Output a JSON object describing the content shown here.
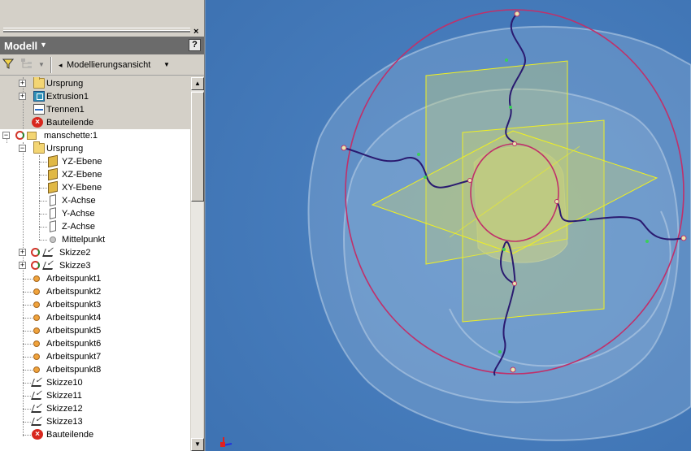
{
  "panel": {
    "close_glyph": "×",
    "title": "Modell",
    "title_arrow": "▼",
    "help_label": "?"
  },
  "toolbar": {
    "filter_icon": "filter-icon",
    "hierarchy_icon": "hierarchy-icon",
    "view_label": "Modellierungsansicht",
    "dropdown_glyph": "▼"
  },
  "tree": {
    "items": [
      {
        "label": "Ursprung",
        "icon": "folder"
      },
      {
        "label": "Extrusion1",
        "icon": "extrude"
      },
      {
        "label": "Trennen1",
        "icon": "split"
      },
      {
        "label": "Bauteilende",
        "icon": "stop"
      },
      {
        "label": "manschette:1",
        "icon": "part"
      },
      {
        "label": "Ursprung",
        "icon": "folder"
      },
      {
        "label": "YZ-Ebene",
        "icon": "plane"
      },
      {
        "label": "XZ-Ebene",
        "icon": "plane"
      },
      {
        "label": "XY-Ebene",
        "icon": "plane"
      },
      {
        "label": "X-Achse",
        "icon": "axis"
      },
      {
        "label": "Y-Achse",
        "icon": "axis"
      },
      {
        "label": "Z-Achse",
        "icon": "axis"
      },
      {
        "label": "Mittelpunkt",
        "icon": "center-point"
      },
      {
        "label": "Skizze2",
        "icon": "sketch"
      },
      {
        "label": "Skizze3",
        "icon": "sketch"
      },
      {
        "label": "Arbeitspunkt1",
        "icon": "work-point"
      },
      {
        "label": "Arbeitspunkt2",
        "icon": "work-point"
      },
      {
        "label": "Arbeitspunkt3",
        "icon": "work-point"
      },
      {
        "label": "Arbeitspunkt4",
        "icon": "work-point"
      },
      {
        "label": "Arbeitspunkt5",
        "icon": "work-point"
      },
      {
        "label": "Arbeitspunkt6",
        "icon": "work-point"
      },
      {
        "label": "Arbeitspunkt7",
        "icon": "work-point"
      },
      {
        "label": "Arbeitspunkt8",
        "icon": "work-point"
      },
      {
        "label": "Skizze10",
        "icon": "sketch"
      },
      {
        "label": "Skizze11",
        "icon": "sketch"
      },
      {
        "label": "Skizze12",
        "icon": "sketch"
      },
      {
        "label": "Skizze13",
        "icon": "sketch"
      },
      {
        "label": "Bauteilende",
        "icon": "stop"
      }
    ]
  },
  "scrollbar": {
    "up": "▲",
    "down": "▼"
  },
  "colors": {
    "viewport_bg": "#4a80c0",
    "curve_magenta": "#c0306a",
    "spline_navy": "#2a1a70",
    "plane_yellow": "#f0f020"
  }
}
